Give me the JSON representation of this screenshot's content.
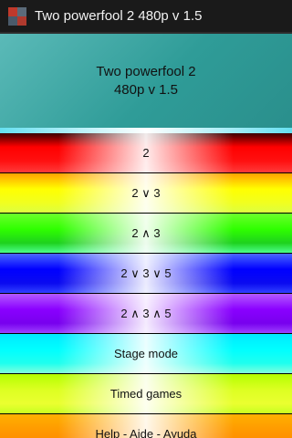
{
  "app": {
    "window_title": "Two powerfool 2 480p v 1.5",
    "icon": "app-logo-icon"
  },
  "header": {
    "line1": "Two powerfool 2",
    "line2": "480p v 1.5"
  },
  "menu": {
    "items": [
      {
        "label": "2",
        "color": "#ff0000"
      },
      {
        "label": "2 ∨ 3",
        "color": "#ffff00"
      },
      {
        "label": "2 ∧ 3",
        "color": "#2fff00"
      },
      {
        "label": "2 ∨ 3 ∨ 5",
        "color": "#0000ff"
      },
      {
        "label": "2 ∧ 3 ∧ 5",
        "color": "#8a00ff"
      },
      {
        "label": "Stage mode",
        "color": "#00ffff"
      },
      {
        "label": "Timed games",
        "color": "#ddff22"
      },
      {
        "label": "Help - Aide - Ayuda",
        "color": "#ff9a00"
      }
    ]
  },
  "colors": {
    "titlebar_bg": "#1a1a1a",
    "header_bg": "#2f9c98",
    "header_separator": "#66e0f0"
  }
}
